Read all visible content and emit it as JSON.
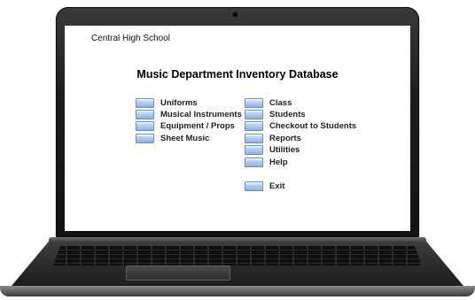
{
  "header": {
    "school_name": "Central High School",
    "title": "Music Department Inventory Database"
  },
  "menu": {
    "left": [
      {
        "label": "Uniforms"
      },
      {
        "label": "Musical Instruments"
      },
      {
        "label": "Equipment / Props"
      },
      {
        "label": "Sheet Music"
      }
    ],
    "right": [
      {
        "label": "Class"
      },
      {
        "label": "Students"
      },
      {
        "label": "Checkout to Students"
      },
      {
        "label": "Reports"
      },
      {
        "label": "Utilities"
      },
      {
        "label": "Help"
      }
    ],
    "exit": {
      "label": "Exit"
    }
  },
  "colors": {
    "button_fill": "#b3cdec",
    "button_border": "#6b8fbf",
    "bezel": "#1c1c1e"
  }
}
